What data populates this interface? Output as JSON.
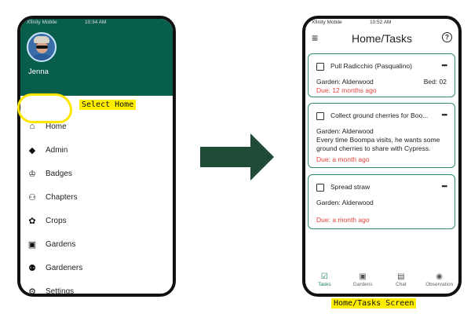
{
  "left_phone": {
    "status": {
      "carrier": "Xfinity Mobile",
      "time": "10:34 AM"
    },
    "user_name": "Jenna",
    "menu": [
      {
        "label": "Home",
        "icon": "home-icon",
        "glyph": "⌂"
      },
      {
        "label": "Admin",
        "icon": "admin-shield-icon",
        "glyph": "◆"
      },
      {
        "label": "Badges",
        "icon": "trophy-icon",
        "glyph": "♔"
      },
      {
        "label": "Chapters",
        "icon": "groups-icon",
        "glyph": "⚇"
      },
      {
        "label": "Crops",
        "icon": "sprout-icon",
        "glyph": "✿"
      },
      {
        "label": "Gardens",
        "icon": "garden-badge-icon",
        "glyph": "▣"
      },
      {
        "label": "Gardeners",
        "icon": "people-icon",
        "glyph": "⚉"
      },
      {
        "label": "Settings",
        "icon": "gear-icon",
        "glyph": "⚙"
      }
    ],
    "annotation": "Select Home"
  },
  "right_phone": {
    "status": {
      "carrier": "Xfinity Mobile",
      "time": "10:52 AM"
    },
    "title": "Home/Tasks",
    "tasks": [
      {
        "title": "Pull Radicchio (Pasqualino)",
        "garden": "Garden: Alderwood",
        "bed": "Bed: 02",
        "description": "",
        "due": "Due: 12 months ago"
      },
      {
        "title": "Collect ground cherries for Boo...",
        "garden": "Garden: Alderwood",
        "bed": "",
        "description": "Every time Boompa visits, he wants some ground cherries to share with Cypress.",
        "due": "Due: a month ago"
      },
      {
        "title": "Spread straw",
        "garden": "Garden: Alderwood",
        "bed": "",
        "description": "",
        "due": "Due: a month ago"
      }
    ],
    "bottom_nav": [
      {
        "label": "Tasks",
        "icon": "checklist-icon",
        "glyph": "☑",
        "active": true
      },
      {
        "label": "Gardens",
        "icon": "garden-badge-icon",
        "glyph": "▣",
        "active": false
      },
      {
        "label": "Chat",
        "icon": "chat-icon",
        "glyph": "▤",
        "active": false
      },
      {
        "label": "Observation",
        "icon": "camera-icon",
        "glyph": "◉",
        "active": false
      }
    ],
    "annotation": "Home/Tasks Screen"
  },
  "colors": {
    "header_green": "#075e4b",
    "card_border": "#2f8a6a",
    "due_red": "#e0443c",
    "highlight_yellow": "#ffee00",
    "arrow_green": "#1f4a35"
  }
}
